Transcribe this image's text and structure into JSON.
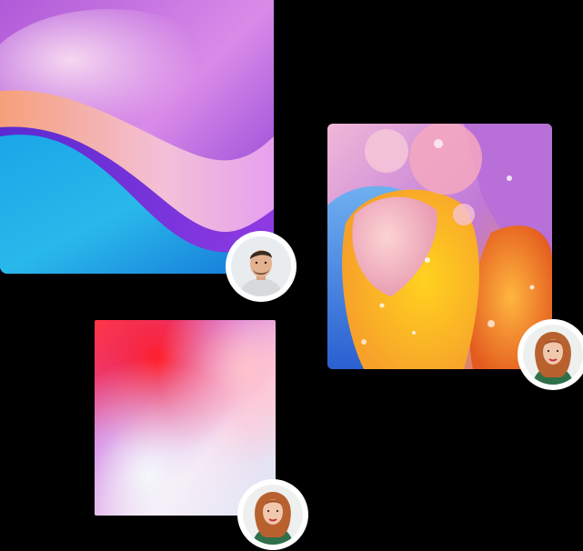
{
  "colors": {
    "background": "#000000",
    "avatar_ring": "#ffffff"
  },
  "cards": [
    {
      "name": "abstract-wave-image"
    },
    {
      "name": "oil-bubbles-image"
    },
    {
      "name": "color-blur-image"
    }
  ],
  "avatars": [
    {
      "name": "man-avatar"
    },
    {
      "name": "woman-avatar"
    },
    {
      "name": "woman-avatar"
    }
  ]
}
